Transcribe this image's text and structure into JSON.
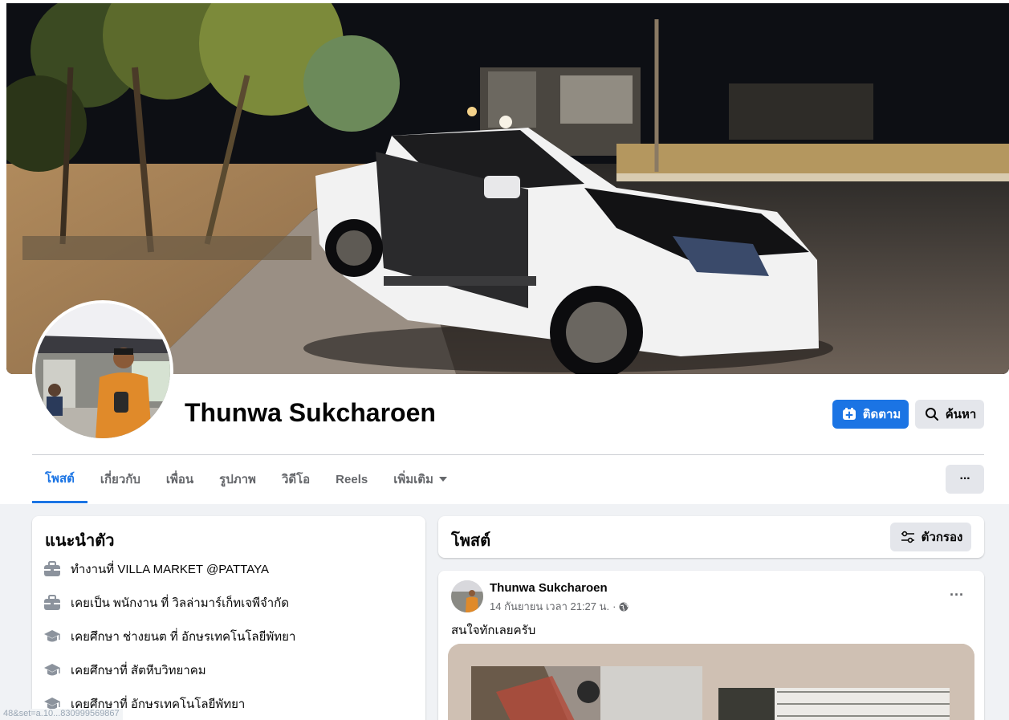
{
  "profile": {
    "name": "Thunwa Sukcharoen",
    "follow_label": "ติดตาม",
    "search_label": "ค้นหา"
  },
  "tabs": [
    {
      "label": "โพสต์",
      "active": true
    },
    {
      "label": "เกี่ยวกับ",
      "active": false
    },
    {
      "label": "เพื่อน",
      "active": false
    },
    {
      "label": "รูปภาพ",
      "active": false
    },
    {
      "label": "วิดีโอ",
      "active": false
    },
    {
      "label": "Reels",
      "active": false
    },
    {
      "label": "เพิ่มเติม",
      "active": false
    }
  ],
  "more_button_label": "···",
  "intro": {
    "title": "แนะนำตัว",
    "items": [
      {
        "icon": "briefcase-icon",
        "text": "ทำงานที่ VILLA MARKET @PATTAYA"
      },
      {
        "icon": "briefcase-icon",
        "text": "เคยเป็น พนักงาน ที่ วิลล่ามาร์เก็ทเจพีจำกัด"
      },
      {
        "icon": "graduation-cap-icon",
        "text": "เคยศึกษา ช่างยนต ที่ อักษรเทคโนโลยีพัทยา"
      },
      {
        "icon": "graduation-cap-icon",
        "text": "เคยศึกษาที่ สัตหีบวิทยาคม"
      },
      {
        "icon": "graduation-cap-icon",
        "text": "เคยศึกษาที่ อักษรเทคโนโลยีพัทยา"
      }
    ]
  },
  "posts_section": {
    "title": "โพสต์",
    "filter_label": "ตัวกรอง"
  },
  "post": {
    "author": "Thunwa Sukcharoen",
    "timestamp": "14 กันยายน เวลา 21:27 น.",
    "separator": "·",
    "privacy_icon": "globe-icon",
    "text": "สนใจทักเลยครับ",
    "more_label": "···"
  },
  "status_text": "48&set=a.10...830999569867",
  "colors": {
    "accent": "#1b74e4",
    "secondary_button": "#e4e6eb",
    "page_background": "#f0f2f5"
  }
}
